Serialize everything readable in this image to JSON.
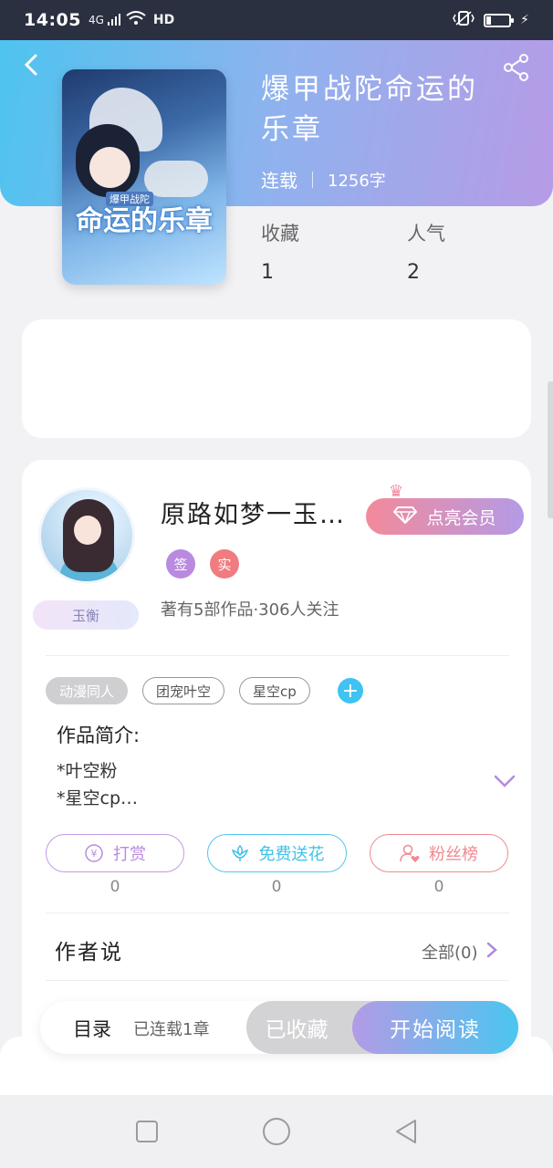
{
  "status_bar": {
    "time": "14:05",
    "network": "4G",
    "hd": "HD"
  },
  "book": {
    "title": "爆甲战陀命运的乐章",
    "status": "连载",
    "word_count": "1256字",
    "cover_small_text": "爆甲战陀",
    "cover_title": "命运的乐章"
  },
  "stats": {
    "collect_label": "收藏",
    "collect_value": "1",
    "popularity_label": "人气",
    "popularity_value": "2"
  },
  "author": {
    "name": "原路如梦一玉…",
    "vip_button": "点亮会员",
    "badge_sign": "签",
    "badge_real": "实",
    "level": "玉衡",
    "summary": "著有5部作品·306人关注"
  },
  "tags": [
    "动漫同人",
    "团宠叶空",
    "星空cp"
  ],
  "intro": {
    "title": "作品简介:",
    "text": "*叶空粉\n*星空cp…"
  },
  "actions": [
    {
      "label": "打赏",
      "count": "0",
      "color": "#b98ae0"
    },
    {
      "label": "免费送花",
      "count": "0",
      "color": "#3fc2ea"
    },
    {
      "label": "粉丝榜",
      "count": "0",
      "color": "#ef8a90"
    }
  ],
  "author_say": {
    "title": "作者说",
    "all_label": "全部(0)"
  },
  "bottom": {
    "catalog": "目录",
    "catalog_sub": "已连载1章",
    "collected": "已收藏",
    "start_read": "开始阅读"
  },
  "colors": {
    "header_start": "#4ec4ef",
    "header_end": "#b79be6",
    "accent_blue": "#3ec3f2",
    "accent_purple": "#b39be6",
    "badge_sign": "#b98ae0",
    "badge_real": "#ef7c80"
  }
}
